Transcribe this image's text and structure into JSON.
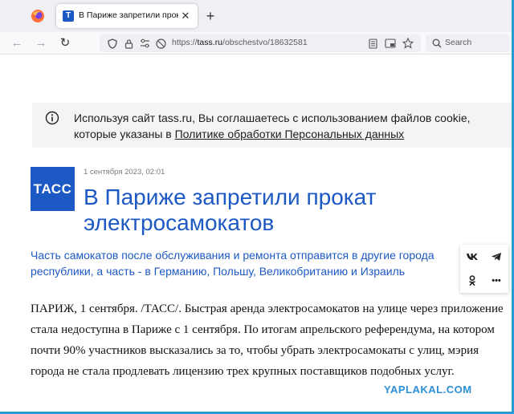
{
  "browser": {
    "tab": {
      "favicon_letter": "T",
      "title": "В Париже запретили прокат элек",
      "close": "✕"
    },
    "new_tab": "+",
    "nav": {
      "back": "←",
      "forward": "→",
      "reload": "↻"
    },
    "url": {
      "prefix": "https://",
      "host": "tass.ru",
      "path": "/obschestvo/18632581"
    },
    "search": {
      "placeholder": "Search"
    }
  },
  "cookie_banner": {
    "text_before": "Используя сайт tass.ru, Вы соглашаетесь с использованием файлов cookie, которые указаны в ",
    "link": "Политике обработки Персональных данных"
  },
  "article": {
    "logo": "ТАСС",
    "date": "1 сентября 2023, 02:01",
    "title": "В Париже запретили прокат электросамокатов",
    "lead": "Часть самокатов после обслуживания и ремонта отправится в другие города республики, а часть - в Германию, Польшу, Великобританию и Израиль",
    "body": "ПАРИЖ, 1 сентября. /ТАСС/. Быстрая аренда электросамокатов на улице через приложение стала недоступна в Париже с 1 сентября. По итогам апрельского референдума, на котором почти 90% участников высказались за то, чтобы убрать электросамокаты с улиц, мэрия города не стала продлевать лицензию трех крупных поставщиков подобных услуг."
  },
  "share": {
    "vk": "vk",
    "ok": "ok",
    "more": "•••"
  },
  "watermark": "YAPLAKAL.COM",
  "colors": {
    "accent": "#1c59c4",
    "watermark": "#2b8fd6"
  }
}
